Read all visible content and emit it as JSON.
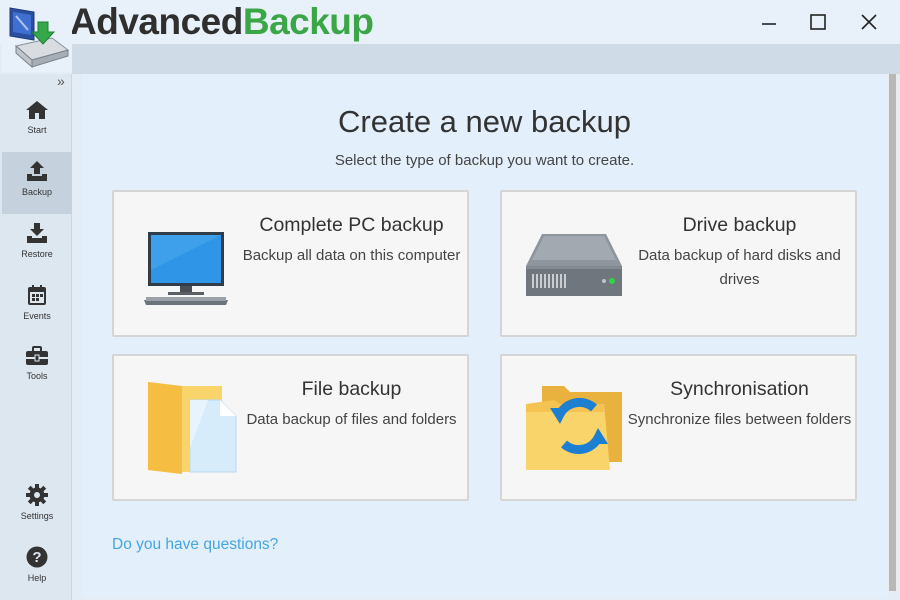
{
  "app": {
    "title_part1": "Advanced",
    "title_part2": "Backup"
  },
  "window_controls": [
    "minimize-icon",
    "maximize-icon",
    "close-icon"
  ],
  "sidebar": {
    "collapse_glyph": "»",
    "items": [
      {
        "label": "Start",
        "icon": "home-icon"
      },
      {
        "label": "Backup",
        "icon": "upload-icon",
        "active": true
      },
      {
        "label": "Restore",
        "icon": "download-icon"
      },
      {
        "label": "Events",
        "icon": "calendar-icon"
      },
      {
        "label": "Tools",
        "icon": "toolbox-icon"
      },
      {
        "label": "Settings",
        "icon": "gear-icon"
      },
      {
        "label": "Help",
        "icon": "question-icon"
      }
    ]
  },
  "main": {
    "title": "Create a new backup",
    "subtitle": "Select the type of backup you want to create.",
    "cards": [
      {
        "title": "Complete PC backup",
        "description": "Backup all data on this computer",
        "icon": "monitor-icon"
      },
      {
        "title": "Drive backup",
        "description": "Data backup of hard disks and drives",
        "icon": "hard-drive-icon"
      },
      {
        "title": "File backup",
        "description": "Data backup of files and folders",
        "icon": "folder-file-icon"
      },
      {
        "title": "Synchronisation",
        "description": "Synchronize files between folders",
        "icon": "folder-sync-icon"
      }
    ],
    "help_link": "Do you have questions?"
  },
  "colors": {
    "brand_green": "#3aa646",
    "link_blue": "#46a5e0",
    "sidebar_bg": "#dde7f0",
    "main_bg": "#e3effb"
  }
}
